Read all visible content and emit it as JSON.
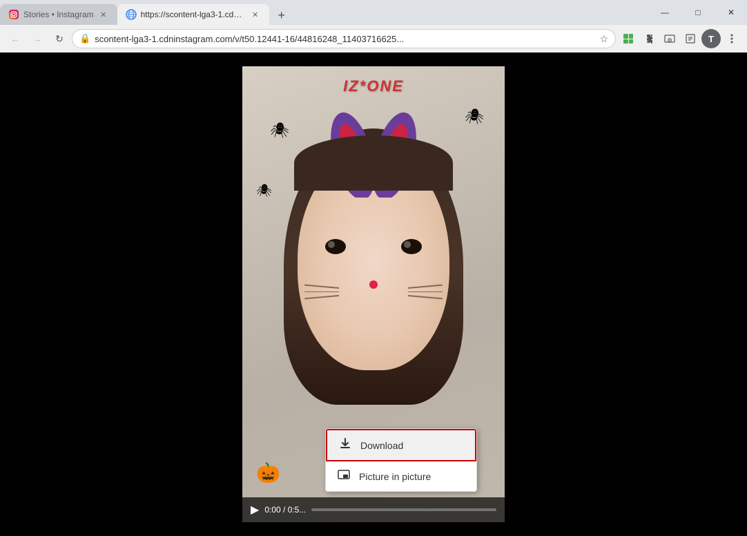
{
  "browser": {
    "tabs": [
      {
        "id": "tab1",
        "favicon": "instagram",
        "title": "Stories • Instagram",
        "active": false,
        "closable": true
      },
      {
        "id": "tab2",
        "favicon": "globe",
        "title": "https://scontent-lga3-1.cdninsta...",
        "active": true,
        "closable": true
      }
    ],
    "new_tab_label": "+",
    "window_controls": {
      "minimize": "—",
      "maximize": "□",
      "close": "✕"
    },
    "address_bar": {
      "url": "scontent-lga3-1.cdninstagram.com/v/t50.12441-16/44816248_11403716625...",
      "secure": true
    },
    "nav": {
      "back": "←",
      "forward": "→",
      "reload": "↻"
    }
  },
  "video": {
    "time_current": "0:00",
    "time_total": "0:5...",
    "time_display": "0:00 / 0:5...",
    "logo": "IZ*ONE"
  },
  "context_menu": {
    "items": [
      {
        "id": "download",
        "icon": "⬇",
        "label": "Download",
        "highlighted": true
      },
      {
        "id": "picture-in-picture",
        "icon": "⬛",
        "label": "Picture in picture",
        "highlighted": false
      }
    ]
  },
  "toolbar": {
    "profile_letter": "T"
  }
}
